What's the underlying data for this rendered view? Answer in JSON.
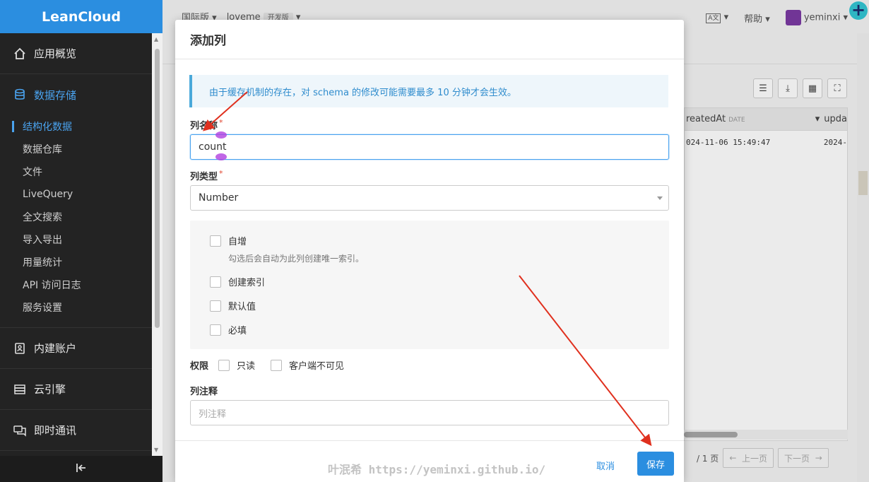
{
  "sidebar": {
    "logo": "LeanCloud",
    "sections": {
      "overview": "应用概览",
      "storage": "数据存储",
      "accounts": "内建账户",
      "engine": "云引擎",
      "im": "即时通讯"
    },
    "storage_items": [
      "结构化数据",
      "数据仓库",
      "文件",
      "LiveQuery",
      "全文搜索",
      "导入导出",
      "用量统计",
      "API 访问日志",
      "服务设置"
    ],
    "collapse_icon": "collapse-left-icon"
  },
  "topbar": {
    "region": "国际版",
    "app": "loveme",
    "env_badge": "开发版",
    "help": "帮助",
    "user": "yeminxi",
    "lang_icon": "translate-icon"
  },
  "grid": {
    "col1_header": "reatedAt",
    "col1_type": "DATE",
    "col2_header": "upda",
    "row1_col1": "024-11-06 15:49:47",
    "row1_col2": "2024-"
  },
  "pager": {
    "page_info": "/ 1 页",
    "prev": "上一页",
    "next": "下一页"
  },
  "modal": {
    "title": "添加列",
    "notice": "由于缓存机制的存在，对 schema 的修改可能需要最多 10 分钟才会生效。",
    "column_name_label": "列名称",
    "column_name_value": "count",
    "column_type_label": "列类型",
    "column_type_value": "Number",
    "required_mark": "*",
    "options": {
      "auto_increment": "自增",
      "auto_increment_hint": "勾选后会自动为此列创建唯一索引。",
      "create_index": "创建索引",
      "default_value": "默认值",
      "required": "必填"
    },
    "permissions": {
      "label": "权限",
      "read_only": "只读",
      "client_invisible": "客户端不可见"
    },
    "comment_label": "列注释",
    "comment_placeholder": "列注释",
    "cancel": "取消",
    "save": "保存"
  },
  "watermark": "叶泯希 https://yeminxi.github.io/",
  "colors": {
    "accent": "#2b8ee0",
    "sidebar_bg": "#232323",
    "arrow_red": "#e0301e",
    "handle_purple": "#b040e0"
  }
}
